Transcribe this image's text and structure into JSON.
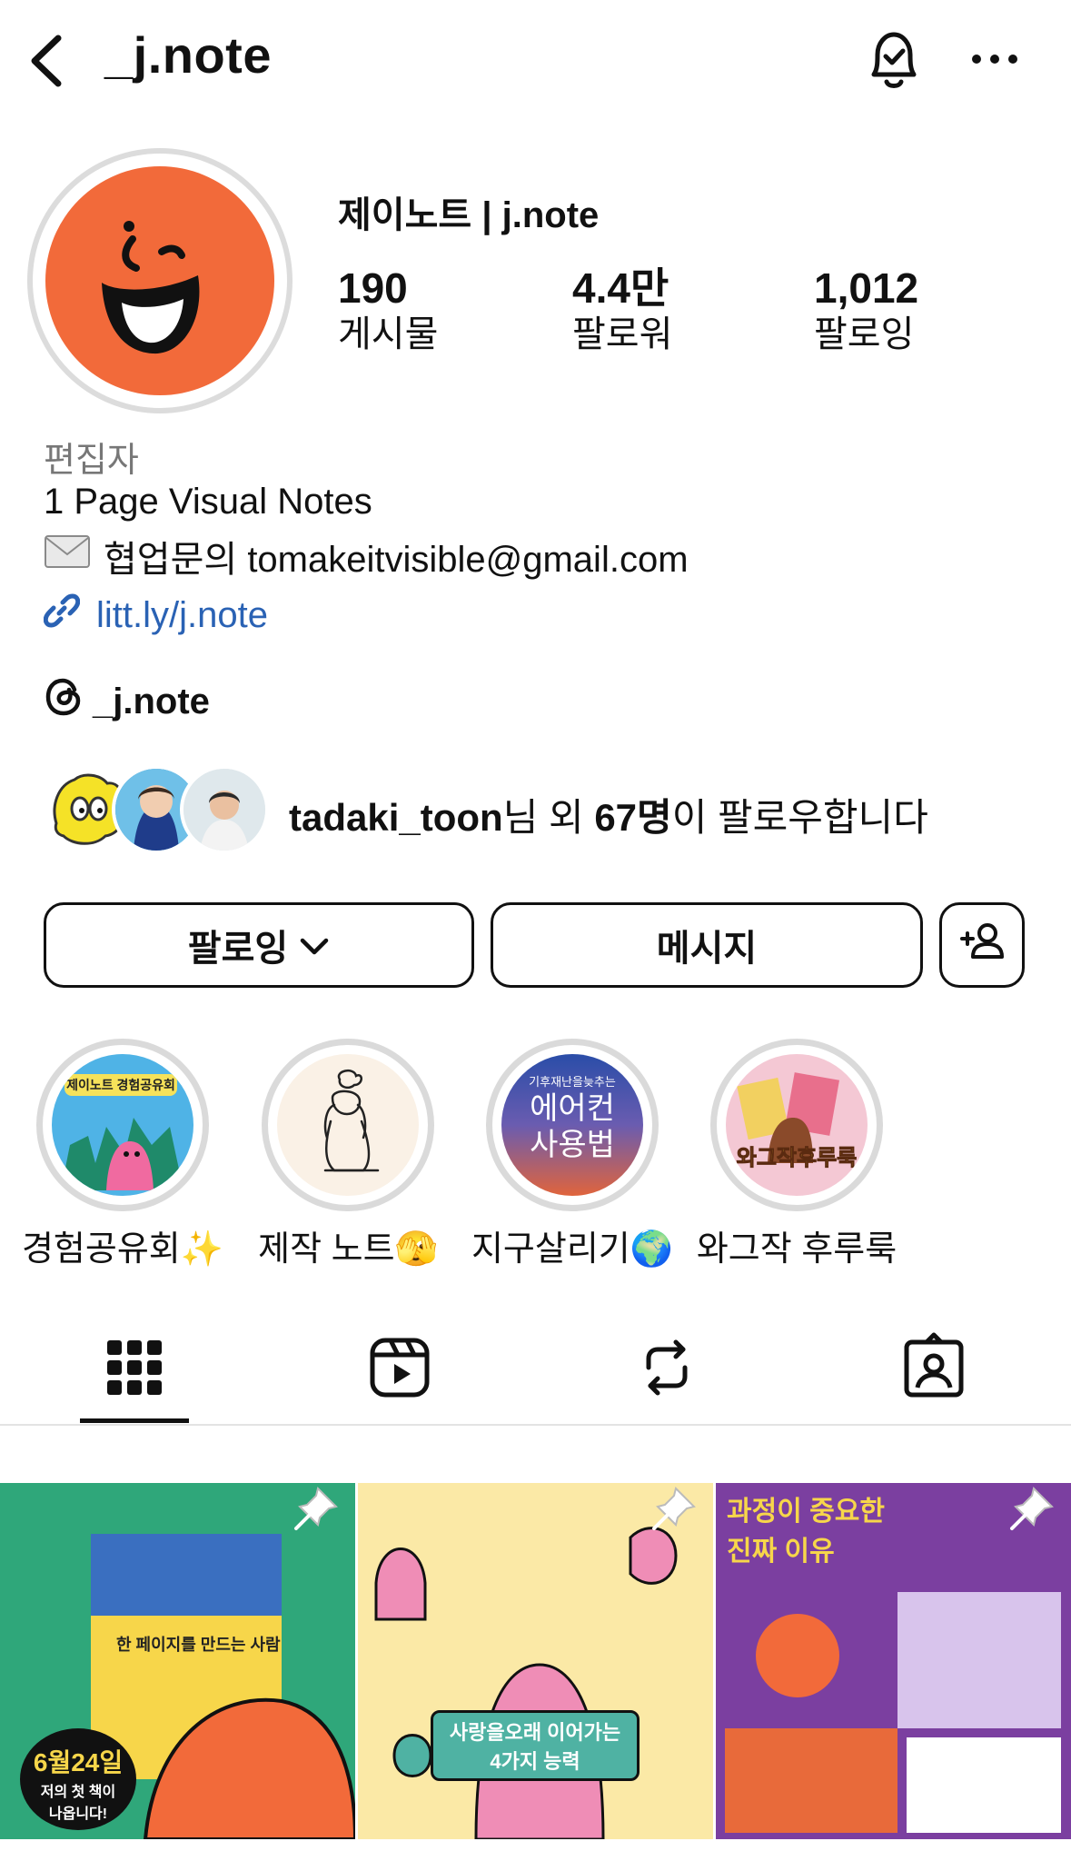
{
  "header": {
    "title": "_j.note"
  },
  "profile": {
    "display_name": "제이노트 |  j.note",
    "stats": [
      {
        "value": "190",
        "label": "게시물"
      },
      {
        "value": "4.4만",
        "label": "팔로워"
      },
      {
        "value": "1,012",
        "label": "팔로잉"
      }
    ],
    "category": "편집자",
    "bio_line1": "1 Page Visual Notes",
    "bio_line2": "협업문의 tomakeitvisible@gmail.com",
    "link": "litt.ly/j.note",
    "threads_handle": "_j.note",
    "followed_by_name": "tadaki_toon",
    "followed_by_mid": "님 외 ",
    "followed_by_count": "67명",
    "followed_by_tail": "이 팔로우합니다"
  },
  "actions": {
    "following_label": "팔로잉",
    "message_label": "메시지"
  },
  "highlights": [
    {
      "label": "경험공유회✨",
      "cover_text": "제이노트 경험공유회"
    },
    {
      "label": "제작 노트🫣",
      "cover_text": ""
    },
    {
      "label": "지구살리기🌍",
      "cover_top": "기후재난을늦추는",
      "cover_main1": "에어컨",
      "cover_main2": "사용법"
    },
    {
      "label": "와그작 후루룩",
      "cover_text": "와그작후루룩"
    }
  ],
  "tabs": [
    "grid",
    "reels",
    "reposts",
    "tagged"
  ],
  "posts": [
    {
      "title": "한 페이지를 만드는 사람",
      "badge_line1": "6월24일",
      "badge_line2": "저의 첫 책이",
      "badge_line3": "나옵니다!"
    },
    {
      "title": "사랑을오래 이어가는",
      "subtitle": "4가지 능력"
    },
    {
      "title": "과정이 중요한",
      "subtitle": "진짜 이유"
    }
  ],
  "colors": {
    "link": "#2a62b4",
    "brand_orange": "#f26a3a",
    "post2_bg": "#fbe9a6",
    "post3_bg": "#7b3fa0"
  }
}
